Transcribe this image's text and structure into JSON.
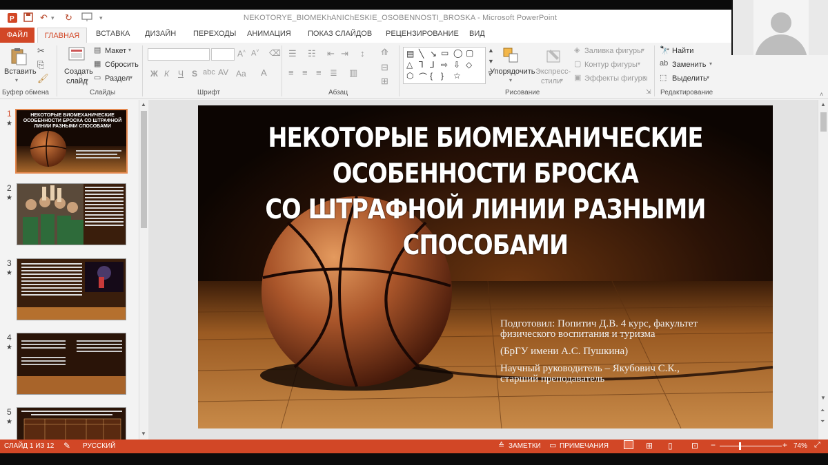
{
  "window": {
    "title": "NEKOTORYE_BIOMEKhANIChESKIE_OSOBENNOSTI_BROSKA - Microsoft PowerPoint"
  },
  "tabs": [
    "ФАЙЛ",
    "ГЛАВНАЯ",
    "ВСТАВКА",
    "ДИЗАЙН",
    "ПЕРЕХОДЫ",
    "АНИМАЦИЯ",
    "ПОКАЗ СЛАЙДОВ",
    "РЕЦЕНЗИРОВАНИЕ",
    "ВИД"
  ],
  "ribbon": {
    "clipboard": {
      "paste": "Вставить",
      "label": "Буфер обмена"
    },
    "slides": {
      "new_slide_1": "Создать",
      "new_slide_2": "слайд",
      "layout": "Макет",
      "reset": "Сбросить",
      "section": "Раздел",
      "label": "Слайды"
    },
    "font": {
      "label": "Шрифт",
      "bold": "Ж",
      "italic": "К",
      "underline": "Ч",
      "strike": "S",
      "aa": "Aa"
    },
    "paragraph": {
      "label": "Абзац"
    },
    "drawing": {
      "arrange": "Упорядочить",
      "quick_styles_1": "Экспресс-",
      "quick_styles_2": "стили",
      "fill": "Заливка фигуры",
      "outline": "Контур фигуры",
      "effects": "Эффекты фигуры",
      "label": "Рисование"
    },
    "editing": {
      "find": "Найти",
      "replace": "Заменить",
      "select": "Выделить",
      "label": "Редактирование"
    }
  },
  "thumbnails": [
    {
      "num": "1",
      "text": "НЕКОТОРЫЕ БИОМЕХАНИЧЕСКИЕ ОСОБЕННОСТИ БРОСКА СО ШТРАФНОЙ ЛИНИИ РАЗНЫМИ СПОСОБАМИ"
    },
    {
      "num": "2",
      "text": ""
    },
    {
      "num": "3",
      "text": ""
    },
    {
      "num": "4",
      "text": ""
    },
    {
      "num": "5",
      "text": ""
    }
  ],
  "slide": {
    "title": [
      "НЕКОТОРЫЕ БИОМЕХАНИЧЕСКИЕ",
      "ОСОБЕННОСТИ БРОСКА",
      "СО ШТРАФНОЙ ЛИНИИ РАЗНЫМИ",
      "СПОСОБАМИ"
    ],
    "subtitle": [
      "Подготовил: Попитич Д.В. 4 курс, факультет",
      "физического воспитания и туризма",
      "(БрГУ имени А.С. Пушкина)",
      "Научный руководитель – Якубович С.К.,",
      "старший преподаватель"
    ]
  },
  "status": {
    "slide_of": "СЛАЙД 1 ИЗ 12",
    "language": "РУССКИЙ",
    "notes": "ЗАМЕТКИ",
    "comments": "ПРИМЕЧАНИЯ",
    "zoom": "74%"
  }
}
